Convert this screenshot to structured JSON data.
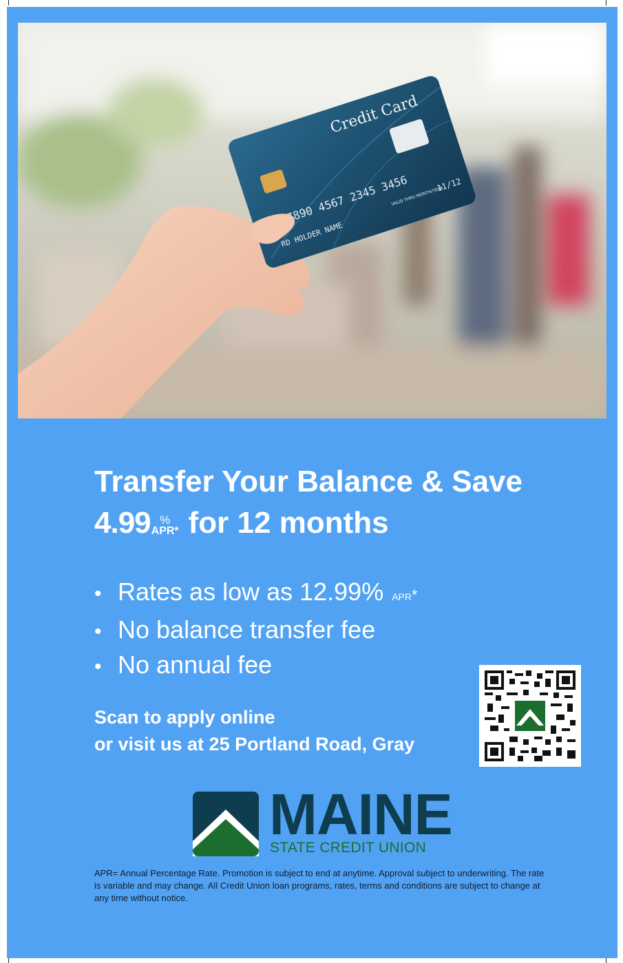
{
  "photo": {
    "card_label": "Credit Card",
    "card_number": "4 7890 4567 2345 3456",
    "card_holder": "RD HOLDER NAME",
    "valid_thru_label": "VALID THRU MONTH/YEAR",
    "expiry": "11/12"
  },
  "headline": {
    "line1": "Transfer Your Balance & Save",
    "rate": "4.99",
    "rate_percent": "%",
    "rate_apr": "APR*",
    "rate_suffix": "for 12 months"
  },
  "bullets": [
    {
      "text": "Rates as low as 12.99%",
      "apr": "APR",
      "star": "*"
    },
    {
      "text": "No balance transfer fee"
    },
    {
      "text": "No annual fee"
    }
  ],
  "bullet_symbol": "•",
  "cta": {
    "line1": "Scan to apply online",
    "line2": "or visit us at 25 Portland Road, Gray"
  },
  "logo": {
    "word": "MAINE",
    "subtitle": "STATE CREDIT UNION"
  },
  "disclaimer": "APR= Annual Percentage Rate. Promotion is subject to end at anytime.  Approval subject to underwriting. The rate is variable and may change. All Credit Union loan programs, rates, terms and conditions are subject to change at any time without notice.",
  "colors": {
    "poster_blue": "#52a2f3",
    "logo_navy": "#0d3d4e",
    "logo_green": "#1c6e2f",
    "card_blue": "#1d4f6e"
  },
  "icons": [
    "qr-code-icon",
    "chip-icon",
    "logo-mountain-icon"
  ]
}
